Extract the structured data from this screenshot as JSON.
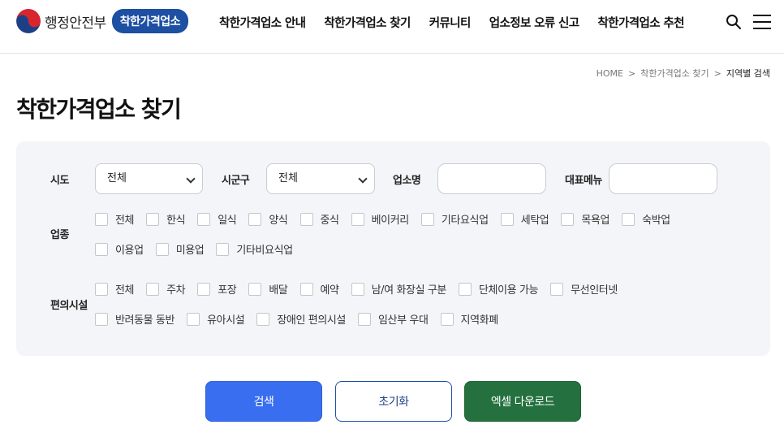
{
  "header": {
    "ministry": "행정안전부",
    "brand": "착한가격업소",
    "nav": [
      "착한가격업소 안내",
      "착한가격업소 찾기",
      "커뮤니티",
      "업소정보 오류 신고",
      "착한가격업소 추천"
    ],
    "icons": {
      "search": "search-icon",
      "menu": "hamburger-menu-icon"
    }
  },
  "breadcrumb": {
    "home": "HOME",
    "section": "착한가격업소 찾기",
    "current": "지역별 검색",
    "separator": ">"
  },
  "page_title": "착한가격업소 찾기",
  "filters": {
    "sido": {
      "label": "시도",
      "value": "전체"
    },
    "sigungu": {
      "label": "시군구",
      "value": "전체"
    },
    "name": {
      "label": "업소명",
      "value": ""
    },
    "menu": {
      "label": "대표메뉴",
      "value": ""
    },
    "industry": {
      "label": "업종",
      "options": [
        "전체",
        "한식",
        "일식",
        "양식",
        "중식",
        "베이커리",
        "기타요식업",
        "세탁업",
        "목욕업",
        "숙박업",
        "이용업",
        "미용업",
        "기타비요식업"
      ]
    },
    "facilities": {
      "label": "편의시설",
      "options": [
        "전체",
        "주차",
        "포장",
        "배달",
        "예약",
        "남/여 화장실 구분",
        "단체이용 가능",
        "무선인터넷",
        "반려동물 동반",
        "유아시설",
        "장애인 편의시설",
        "임산부 우대",
        "지역화폐"
      ]
    }
  },
  "buttons": {
    "search": "검색",
    "reset": "초기화",
    "excel": "엑셀 다운로드"
  },
  "colors": {
    "brand": "#1d4fa3",
    "search_button": "#3a6ef0",
    "excel_button": "#24713f",
    "panel_bg": "#f4f5f8"
  }
}
